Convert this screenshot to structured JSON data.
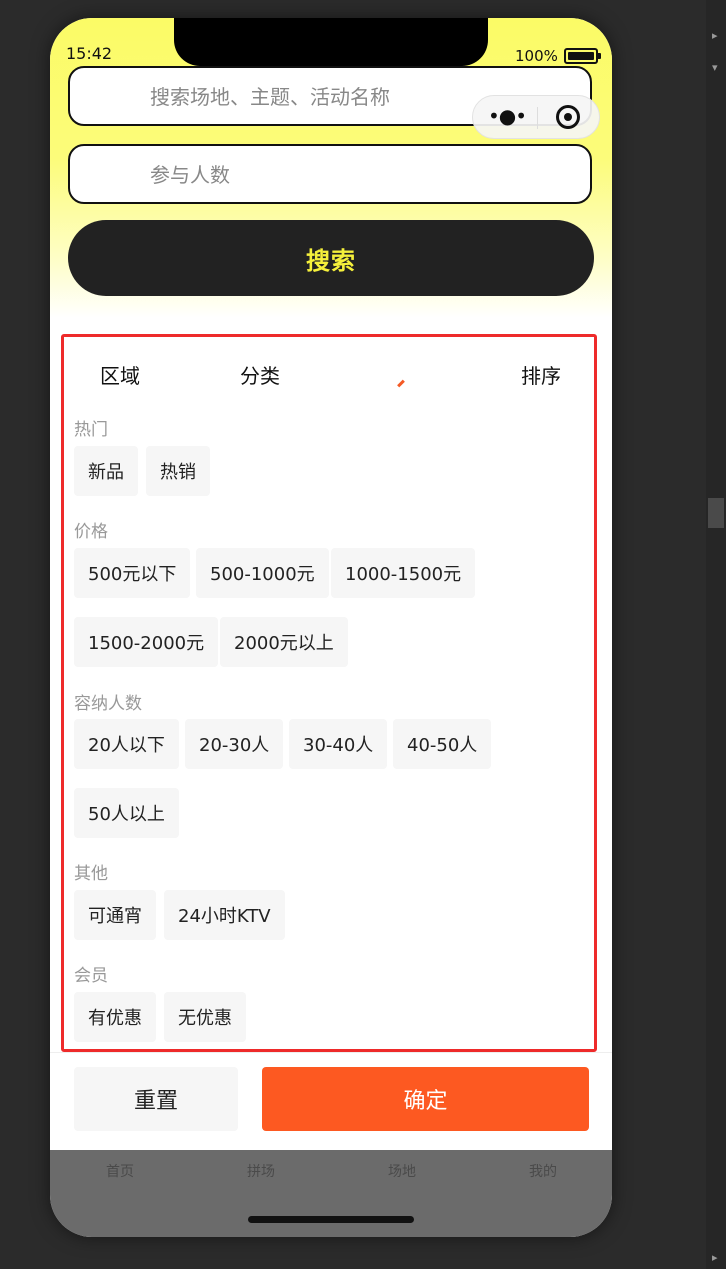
{
  "status_bar": {
    "time": "15:42",
    "battery": "100%"
  },
  "search": {
    "keyword_placeholder": "搜索场地、主题、活动名称",
    "people_placeholder": "参与人数",
    "button_label": "搜索"
  },
  "capsule": {
    "more_icon": "ellipsis-icon",
    "close_icon": "target-icon"
  },
  "filter": {
    "tabs": [
      "区域",
      "分类",
      "排序"
    ],
    "sections": [
      {
        "title": "热门",
        "options": [
          "新品",
          "热销"
        ]
      },
      {
        "title": "价格",
        "options": [
          "500元以下",
          "500-1000元",
          "1000-1500元",
          "1500-2000元",
          "2000元以上"
        ]
      },
      {
        "title": "容纳人数",
        "options": [
          "20人以下",
          "20-30人",
          "30-40人",
          "40-50人",
          "50人以上"
        ]
      },
      {
        "title": "其他",
        "options": [
          "可通宵",
          "24小时KTV"
        ]
      },
      {
        "title": "会员",
        "options": [
          "有优惠",
          "无优惠"
        ]
      }
    ],
    "reset_label": "重置",
    "confirm_label": "确定"
  },
  "tabbar": {
    "items": [
      "首页",
      "拼场",
      "场地",
      "我的"
    ]
  },
  "colors": {
    "header_yellow": "#fbfb66",
    "accent_orange": "#fd5921",
    "highlight_red": "#ee2a2a",
    "search_text": "#f5f03b"
  }
}
